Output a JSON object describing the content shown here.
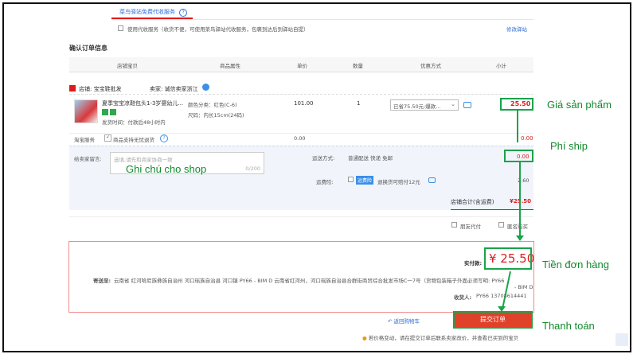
{
  "pickup": {
    "title": "菜鸟驿站免费代收服务",
    "checkbox_label": "使用代收服务（收货不便，可使用菜鸟驿站代收服务，包裹到达后到驿站自提）",
    "modify_link": "修改驿站"
  },
  "section_title": "确认订单信息",
  "table_headers": [
    "店铺宝贝",
    "商品属性",
    "单价",
    "数量",
    "优惠方式",
    "小计"
  ],
  "shop": {
    "name_prefix": "店铺:",
    "name": "宝宝鞋批发",
    "seller_prefix": "卖家:",
    "seller": "诚信卖家浙江"
  },
  "item": {
    "title": "夏季宝宝凉鞋包头1-3岁婴幼儿...",
    "delivery": "发货时间：付款后48小时内",
    "attr_color": "颜色分类：红色(C-6)",
    "attr_size": "尺码：内长15cm(24码)",
    "unit_price": "101.00",
    "quantity": "1",
    "discount": "已省75.50元:爆款...",
    "subtotal": "25.50"
  },
  "service": {
    "label": "淘宝服务",
    "option": "商品支持无忧退货",
    "price": "0.00",
    "price_right": "0.00"
  },
  "message": {
    "label": "给卖家留言:",
    "placeholder": "选填,请先和商家协商一致",
    "counter": "0/200"
  },
  "shipping": {
    "method_label": "运送方式:",
    "method_value": "普通配送 快递 免邮",
    "fee": "0.00",
    "insurance_label": "运费险:",
    "insurance_badge": "运费险",
    "insurance_text": "退换货可赔付12元",
    "insurance_price": "2.60"
  },
  "shop_total": {
    "label": "店铺合计(含运费)",
    "value": "¥25.50"
  },
  "options": {
    "friend_pay": "朋友代付",
    "anon": "匿名购买"
  },
  "summary": {
    "paid_label": "实付款:",
    "paid_amount": "¥ 25.50",
    "address_label": "寄送至:",
    "address": "云南省 红河哈尼族彝族自治州 河口瑶族自治县 河口镇 PY66 - BIM D 云南省红河州，河口瑶族自治县合群街商贸综合批发市场C一7号（货物包装箱子外面必须写明: PY66",
    "address_tail": "- BIM D",
    "receiver_label": "收货人:",
    "receiver": "PY66 13708614441"
  },
  "back_link": "返回购物车",
  "submit_button": "提交订单",
  "notice": "若价格变动，请在提交订单后联系卖家改价，并查看已买到的宝贝",
  "annotations": {
    "product_price": "Giá sản phẩm",
    "ship_fee": "Phí ship",
    "shop_note": "Ghi chú cho shop",
    "order_total": "Tiền đơn hàng",
    "payment": "Thanh toán"
  },
  "colors": {
    "accent_red": "#e01b1b",
    "annotation_green": "#1aa34a",
    "link_blue": "#2f6fd6"
  }
}
